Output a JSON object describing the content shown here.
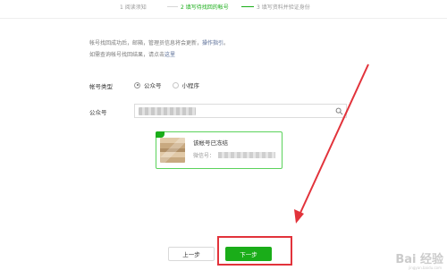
{
  "steps": [
    {
      "label": "1 阅读须知",
      "active": false
    },
    {
      "label": "2 填写待找回的帐号",
      "active": true
    },
    {
      "label": "3 填写资料并验证身份",
      "active": false
    }
  ],
  "notice": {
    "line1_text": "帐号找回成功后，邮箱，管理员信息将会更新，",
    "line1_link": "操作指引",
    "line1_end": "。",
    "line2_text": "如需查询帐号找回结果，请点击",
    "line2_link": "这里"
  },
  "form": {
    "account_type_label": "帐号类型",
    "account_type_options": [
      "公众号",
      "小程序"
    ],
    "account_type_selected": "公众号",
    "account_label": "公众号",
    "account_value_obscured": true
  },
  "result_card": {
    "title": "该帐号已冻结",
    "sub_label": "微信号："
  },
  "buttons": {
    "prev": "上一步",
    "next": "下一步"
  },
  "watermark": {
    "text": "Bai 经验",
    "sub": "jingyan.baidu.com"
  },
  "colors": {
    "accent": "#1aad19",
    "annotation": "#e2333b",
    "link": "#576b95"
  }
}
